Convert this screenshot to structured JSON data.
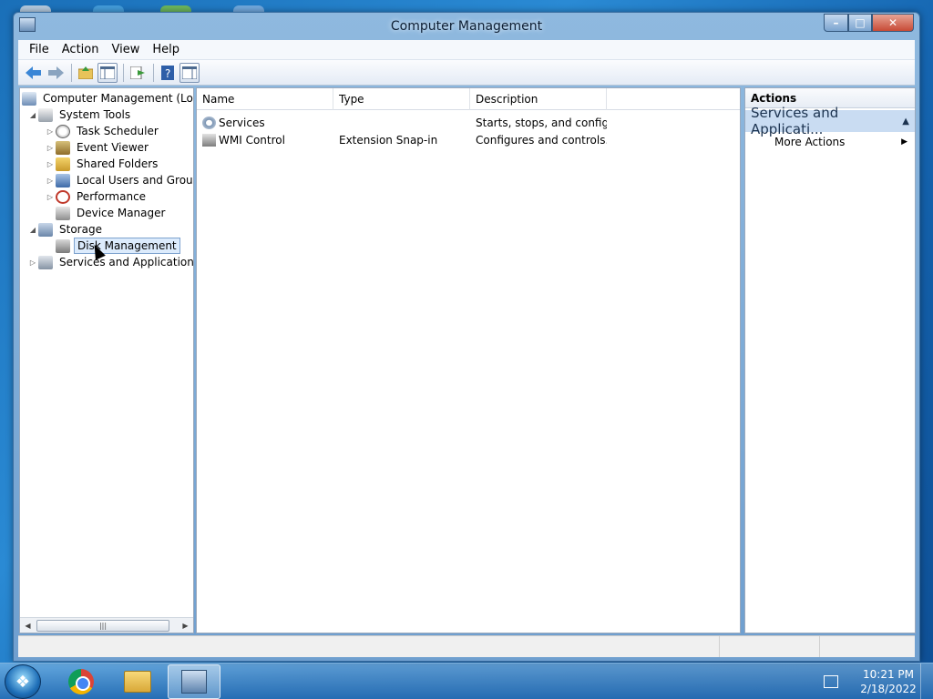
{
  "window": {
    "title": "Computer Management"
  },
  "menu": [
    "File",
    "Action",
    "View",
    "Help"
  ],
  "toolbar_icons": [
    "back-arrow-icon",
    "forward-arrow-icon",
    "up-folder-icon",
    "show-hide-tree-icon",
    "export-list-icon",
    "help-icon",
    "show-hide-action-pane-icon"
  ],
  "tree": [
    {
      "label": "Computer Management (Local",
      "icon": "computer-management-icon",
      "expander": "",
      "indent": 0
    },
    {
      "label": "System Tools",
      "icon": "tools-icon",
      "expander": "expanded",
      "indent": 1
    },
    {
      "label": "Task Scheduler",
      "icon": "clock-icon",
      "expander": "collapsed",
      "indent": 2
    },
    {
      "label": "Event Viewer",
      "icon": "event-viewer-icon",
      "expander": "collapsed",
      "indent": 2
    },
    {
      "label": "Shared Folders",
      "icon": "shared-folder-icon",
      "expander": "collapsed",
      "indent": 2
    },
    {
      "label": "Local Users and Groups",
      "icon": "users-icon",
      "expander": "collapsed",
      "indent": 2
    },
    {
      "label": "Performance",
      "icon": "performance-icon",
      "expander": "collapsed",
      "indent": 2
    },
    {
      "label": "Device Manager",
      "icon": "device-manager-icon",
      "expander": "",
      "indent": 2
    },
    {
      "label": "Storage",
      "icon": "storage-icon",
      "expander": "expanded",
      "indent": 1
    },
    {
      "label": "Disk Management",
      "icon": "disk-icon",
      "expander": "",
      "indent": 2,
      "selected": true
    },
    {
      "label": "Services and Applications",
      "icon": "services-apps-icon",
      "expander": "collapsed",
      "indent": 1
    }
  ],
  "list": {
    "columns": [
      "Name",
      "Type",
      "Description"
    ],
    "rows": [
      {
        "name": "Services",
        "type": "",
        "description": "Starts, stops, and config...",
        "icon": "services-gear-icon"
      },
      {
        "name": "WMI Control",
        "type": "Extension Snap-in",
        "description": "Configures and controls...",
        "icon": "wmi-control-icon"
      }
    ]
  },
  "actions": {
    "header": "Actions",
    "section": "Services and Applicati...",
    "items": [
      "More Actions"
    ]
  },
  "taskbar": {
    "apps": [
      "chrome-icon",
      "file-explorer-icon",
      "computer-management-icon"
    ],
    "time": "10:21 PM",
    "date": "2/18/2022"
  },
  "colors": {
    "selection": "#dcebfc",
    "action_section": "#c9dcf2",
    "window_frame": "#7fa9d4"
  }
}
